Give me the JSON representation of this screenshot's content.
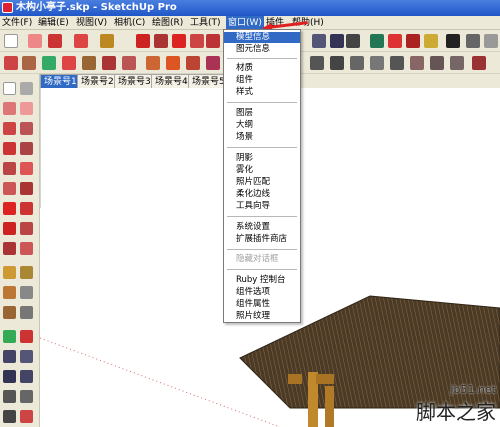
{
  "window": {
    "title": "木构小亭子.skp - SketchUp Pro"
  },
  "menubar": {
    "items": [
      {
        "label": "文件(F)"
      },
      {
        "label": "编辑(E)"
      },
      {
        "label": "视图(V)"
      },
      {
        "label": "相机(C)"
      },
      {
        "label": "绘图(R)"
      },
      {
        "label": "工具(T)"
      },
      {
        "label": "窗口(W)"
      },
      {
        "label": "插件"
      },
      {
        "label": "帮助(H)"
      }
    ],
    "active_index": 6
  },
  "scene_tabs": {
    "items": [
      {
        "label": "场景号1"
      },
      {
        "label": "场景号2"
      },
      {
        "label": "场景号3"
      },
      {
        "label": "场景号4"
      },
      {
        "label": "场景号5"
      }
    ],
    "active_index": 0
  },
  "window_menu": {
    "items": [
      {
        "label": "模型信息",
        "state": "highlighted"
      },
      {
        "label": "图元信息",
        "state": "normal"
      },
      {
        "label": "材质",
        "state": "normal"
      },
      {
        "label": "组件",
        "state": "normal"
      },
      {
        "label": "样式",
        "state": "normal"
      },
      {
        "label": "图层",
        "state": "normal"
      },
      {
        "label": "大纲",
        "state": "normal"
      },
      {
        "label": "场景",
        "state": "normal"
      },
      {
        "label": "阴影",
        "state": "normal"
      },
      {
        "label": "雾化",
        "state": "normal"
      },
      {
        "label": "照片匹配",
        "state": "normal"
      },
      {
        "label": "柔化边线",
        "state": "normal"
      },
      {
        "label": "工具向导",
        "state": "normal"
      },
      {
        "label": "系统设置",
        "state": "normal"
      },
      {
        "label": "扩展插件商店",
        "state": "normal"
      },
      {
        "label": "隐藏对话框",
        "state": "disabled"
      },
      {
        "label": "Ruby 控制台",
        "state": "normal"
      },
      {
        "label": "组件选项",
        "state": "normal"
      },
      {
        "label": "组件属性",
        "state": "normal"
      },
      {
        "label": "照片纹理",
        "state": "normal"
      }
    ]
  },
  "watermark": {
    "url": "jb51.net",
    "text": "脚本之家"
  },
  "colors": {
    "title_bar": "#1f56c8",
    "menu_highlight": "#316ac5",
    "arrow": "#e02020",
    "roof": "#4a3a26",
    "column": "#c08a2c"
  }
}
